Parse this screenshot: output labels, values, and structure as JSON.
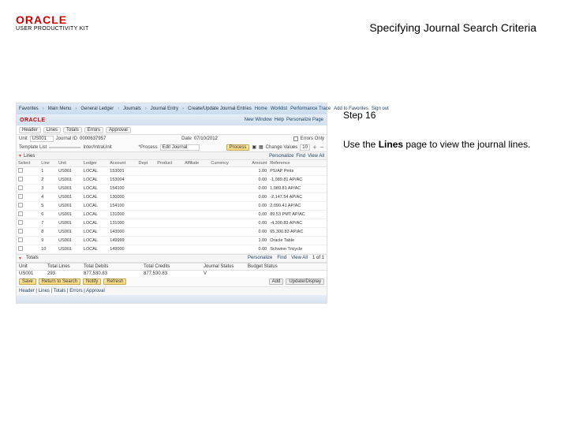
{
  "header": {
    "logo": "ORACLE",
    "logo_sub": "USER PRODUCTIVITY KIT",
    "title": "Specifying Journal Search Criteria"
  },
  "step": {
    "label": "Step 16",
    "text_pre": "Use the ",
    "text_bold": "Lines",
    "text_post": " page to view the journal lines."
  },
  "app": {
    "breadcrumb": {
      "items": [
        "Favorites",
        "Main Menu",
        "General Ledger",
        "Journals",
        "Journal Entry",
        "Create/Update Journal Entries"
      ],
      "right": [
        "Home",
        "Worklist",
        "Performance Trace",
        "Add to Favorites",
        "Sign out"
      ]
    },
    "brand": {
      "logo": "ORACLE",
      "right": [
        "New Window",
        "Help",
        "Personalize Page"
      ]
    },
    "tabs": [
      "Header",
      "Lines",
      "Totals",
      "Errors",
      "Approval"
    ],
    "form": {
      "unit_lbl": "Unit",
      "unit": "US001",
      "jid_lbl": "Journal ID",
      "jid": "0000637957",
      "date_lbl": "Date",
      "date": "07/10/2012",
      "err_lbl": "Errors Only",
      "template_lbl": "Template List",
      "line_lbl": "Change Values",
      "interintra_lbl": "Inter/IntraUnit",
      "process_lbl": "*Process",
      "process_val": "Edit Journal",
      "process_btn": "Process",
      "line_value": "10",
      "controls": [
        "▣",
        "▦"
      ]
    },
    "lines_label": "Lines",
    "right_links": [
      "Personalize",
      "Find",
      "View All"
    ],
    "columns": [
      "Select",
      "Line",
      "Unit",
      "Ledger",
      "Account",
      "Dept",
      "Product",
      "Affiliate",
      "Currency",
      "Amount",
      "Reference"
    ],
    "rows": [
      {
        "line": "1",
        "unit": "US001",
        "ledger": "LOCAL",
        "acct": "153001",
        "amt": "1.00",
        "ref": "PS/AP Pmts"
      },
      {
        "line": "2",
        "unit": "US001",
        "ledger": "LOCAL",
        "acct": "153004",
        "amt": "0.00",
        "ref": "-1,089.81 AP/AC"
      },
      {
        "line": "3",
        "unit": "US001",
        "ledger": "LOCAL",
        "acct": "154100",
        "amt": "0.00",
        "ref": "1,089.81 AP/AC"
      },
      {
        "line": "4",
        "unit": "US001",
        "ledger": "LOCAL",
        "acct": "130000",
        "amt": "0.00",
        "ref": "-2,147.54 AP/AC"
      },
      {
        "line": "5",
        "unit": "US001",
        "ledger": "LOCAL",
        "acct": "154100",
        "amt": "0.00",
        "ref": "2,090.41 AP/AC"
      },
      {
        "line": "6",
        "unit": "US001",
        "ledger": "LOCAL",
        "acct": "131000",
        "amt": "0.00",
        "ref": "89.53 PMT AP/AC"
      },
      {
        "line": "7",
        "unit": "US001",
        "ledger": "LOCAL",
        "acct": "131000",
        "amt": "0.00",
        "ref": "-4,300.83 AP/AC"
      },
      {
        "line": "8",
        "unit": "US001",
        "ledger": "LOCAL",
        "acct": "143000",
        "amt": "0.00",
        "ref": "65,300.83 AP/AC"
      },
      {
        "line": "9",
        "unit": "US001",
        "ledger": "LOCAL",
        "acct": "149999",
        "amt": "1.00",
        "ref": "Oracle Table"
      },
      {
        "line": "10",
        "unit": "US001",
        "ledger": "LOCAL",
        "acct": "149000",
        "amt": "0.00",
        "ref": "Schwinn Tricycle"
      }
    ],
    "totals": {
      "label": "Totals",
      "headers": [
        "Unit",
        "Total Lines",
        "Total Debits",
        "Total Credits",
        "Journal Status",
        "Budget Status"
      ],
      "values": [
        "US001",
        "293",
        "877,530.83",
        "877,530.83",
        "V",
        ""
      ],
      "right": [
        "Personalize",
        "Find",
        "View All",
        "1 of 1"
      ]
    },
    "bottom": {
      "buttons": [
        "Save",
        "Return to Search",
        "Notify",
        "Refresh"
      ],
      "add_btn": "Add",
      "update_btn": "Update/Display"
    },
    "footer_links": "Header | Lines | Totals | Errors | Approval"
  }
}
